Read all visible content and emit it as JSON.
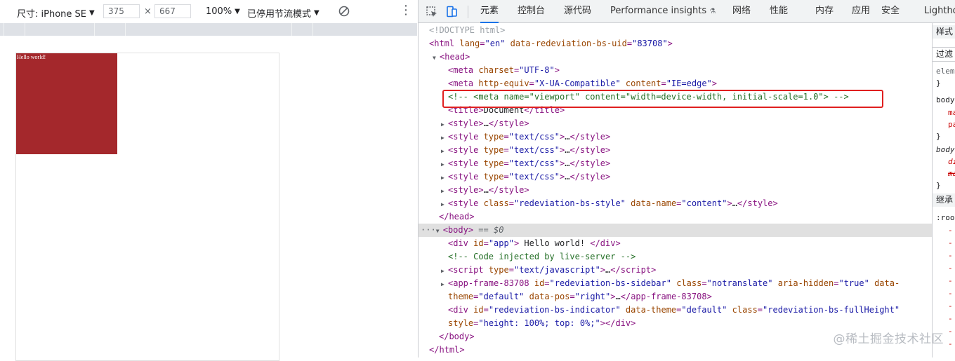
{
  "device_toolbar": {
    "device_label": "尺寸: iPhone SE",
    "width": "375",
    "height": "667",
    "times": "×",
    "zoom": "100%",
    "throttle": "已停用节流模式"
  },
  "page": {
    "app_text": "Hello world!"
  },
  "devtools": {
    "tabs": [
      "元素",
      "控制台",
      "源代码",
      "Performance insights",
      "网络",
      "性能",
      "内存",
      "应用",
      "安全",
      "Lightho"
    ],
    "active_tab": "元素",
    "performance_insights_badge": "⚗"
  },
  "dom": {
    "doctype": "<!DOCTYPE html>",
    "html_open": {
      "tag": "html",
      "attrs": [
        [
          "lang",
          "en"
        ],
        [
          "data-redeviation-bs-uid",
          "83708"
        ]
      ]
    },
    "head_open": "head",
    "meta_charset": {
      "attr": "charset",
      "val": "UTF-8"
    },
    "meta_http": {
      "a1": "http-equiv",
      "v1": "X-UA-Compatible",
      "a2": "content",
      "v2": "IE=edge"
    },
    "meta_viewport_comment": "<!-- <meta name=\"viewport\" content=\"width=device-width, initial-scale=1.0\"> -->",
    "title": {
      "tag": "title",
      "text": "Document"
    },
    "style_plain": "style",
    "style_typed": {
      "attr": "type",
      "val": "text/css"
    },
    "style_class": {
      "a1": "class",
      "v1": "redeviation-bs-style",
      "a2": "data-name",
      "v2": "content"
    },
    "ellipsis": "…",
    "head_close": "head",
    "body_open": "body",
    "body_dollar": "== $0",
    "div_app": {
      "attr": "id",
      "val": "app",
      "text": " Hello world! "
    },
    "live_server_comment": "<!-- Code injected by live-server -->",
    "script_tag": {
      "tag": "script",
      "attr": "type",
      "val": "text/javascript"
    },
    "app_frame": {
      "tag": "app-frame-83708",
      "a1": "id",
      "v1": "redeviation-bs-sidebar",
      "a2": "class",
      "v2": "notranslate",
      "a3": "aria-hidden",
      "v3": "true",
      "a4": "data-theme",
      "v4": "default",
      "a5": "data-pos",
      "v5": "right"
    },
    "indicator": {
      "a1": "id",
      "v1": "redeviation-bs-indicator",
      "a2": "data-theme",
      "v2": "default",
      "a3": "class",
      "v3": "redeviation-bs-fullHeight",
      "a4": "style",
      "v4": "height: 100%; top: 0%;"
    },
    "body_close": "body",
    "html_close": "html"
  },
  "styles_pane": {
    "header": "样式",
    "filter": "过滤",
    "element_rule": "elem",
    "close_brace": "}",
    "body1": "body",
    "prop_m": "ma",
    "prop_p": "pa",
    "body2": "body",
    "prop_d": "di",
    "prop_m2": "ma",
    "inherited": "继承",
    "root": ":roo",
    "dash": "-"
  },
  "watermark": "@稀土掘金技术社区",
  "colors": {
    "app_background": "#a4282c",
    "highlight": "#e02020",
    "active_tab": "#1a73e8"
  }
}
